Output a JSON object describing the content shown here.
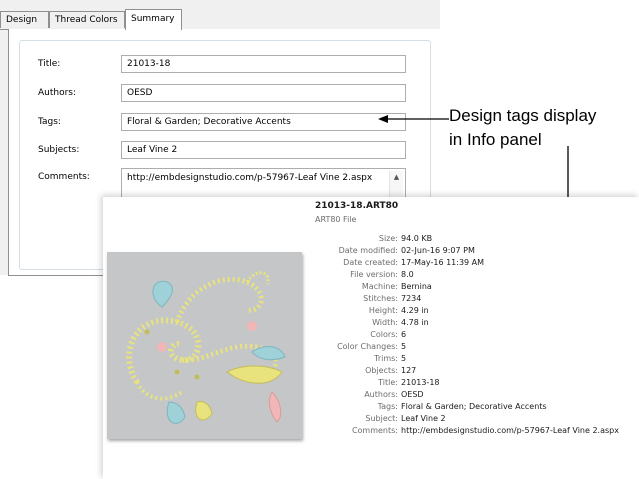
{
  "tabs": [
    {
      "label": "Design"
    },
    {
      "label": "Thread Colors"
    },
    {
      "label": "Summary"
    }
  ],
  "summary": {
    "fields": [
      {
        "label": "Title:",
        "value": "21013-18"
      },
      {
        "label": "Authors:",
        "value": "OESD"
      },
      {
        "label": "Tags:",
        "value": "Floral & Garden; Decorative Accents"
      },
      {
        "label": "Subjects:",
        "value": "Leaf Vine 2"
      },
      {
        "label": "Comments:",
        "value": "http://embdesignstudio.com/p-57967-Leaf Vine 2.aspx"
      }
    ]
  },
  "callout": {
    "line1": "Design tags display",
    "line2": "in Info panel"
  },
  "info_panel": {
    "file_name": "21013-18.ART80",
    "file_type": "ART80 File",
    "properties": [
      {
        "key": "Size:",
        "value": "94.0 KB"
      },
      {
        "key": "Date modified:",
        "value": "02-Jun-16 9:07 PM"
      },
      {
        "key": "Date created:",
        "value": "17-May-16 11:39 AM"
      },
      {
        "key": "File version:",
        "value": "8.0"
      },
      {
        "key": "Machine:",
        "value": "Bernina"
      },
      {
        "key": "Stitches:",
        "value": "7234"
      },
      {
        "key": "Height:",
        "value": "4.29 in"
      },
      {
        "key": "Width:",
        "value": "4.78 in"
      },
      {
        "key": "Colors:",
        "value": "6"
      },
      {
        "key": "Color Changes:",
        "value": "5"
      },
      {
        "key": "Trims:",
        "value": "5"
      },
      {
        "key": "Objects:",
        "value": "127"
      },
      {
        "key": "Title:",
        "value": "21013-18"
      },
      {
        "key": "Authors:",
        "value": "OESD"
      },
      {
        "key": "Tags:",
        "value": "Floral & Garden; Decorative Accents"
      },
      {
        "key": "Subject:",
        "value": "Leaf Vine 2"
      },
      {
        "key": "Comments:",
        "value": "http://embdesignstudio.com/p-57967-Leaf Vine 2.aspx"
      }
    ]
  },
  "colors": {
    "preview_bg": "#c4c6c8",
    "thread_yellow": "#e8e37c",
    "thread_blue": "#9fd1d8",
    "thread_pink": "#f1b6b6",
    "thread_olive": "#c4bc5a"
  }
}
